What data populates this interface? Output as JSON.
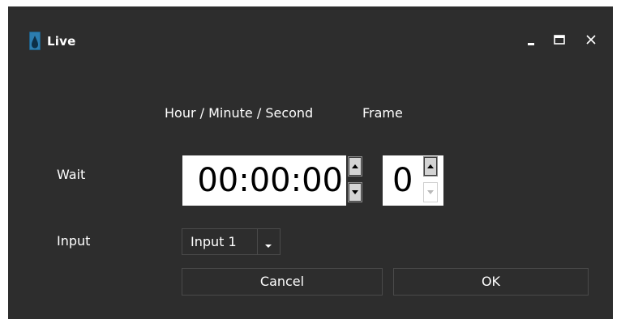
{
  "window": {
    "title": "Live",
    "icon": "water-drop-icon",
    "controls": [
      "minimize-icon",
      "maximize-icon",
      "close-icon"
    ],
    "background": "#2d2d2d"
  },
  "headers": {
    "time": "Hour / Minute / Second",
    "frame": "Frame"
  },
  "wait": {
    "label": "Wait",
    "time_value": "00:00:00",
    "frame_value": "0"
  },
  "input": {
    "label": "Input",
    "selected": "Input 1"
  },
  "buttons": {
    "cancel": "Cancel",
    "ok": "OK"
  }
}
